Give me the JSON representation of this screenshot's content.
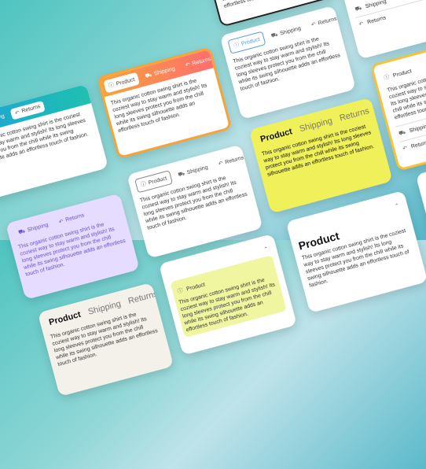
{
  "tabs": {
    "product": "Product",
    "shipping": "Shipping",
    "returns": "Returns"
  },
  "body": "This organic cotton swing shirt is the coziest way to stay warm and stylish! Its long sleeves protect you from the chill while its swing silhouette adds an effortless touch of fashion.",
  "icons": {
    "product": "info-icon",
    "shipping": "truck-icon",
    "returns": "return-arrow-icon",
    "collapse": "chevron-up-icon"
  },
  "colors": {
    "bg_teal": "#4fc4c0",
    "gradient_blue": "#1aa3d9",
    "gradient_orange": "#f6a33a",
    "yellow": "#f0f05a",
    "purple": "#e6dcff",
    "peach_gradient_end": "#ff6e6e"
  }
}
